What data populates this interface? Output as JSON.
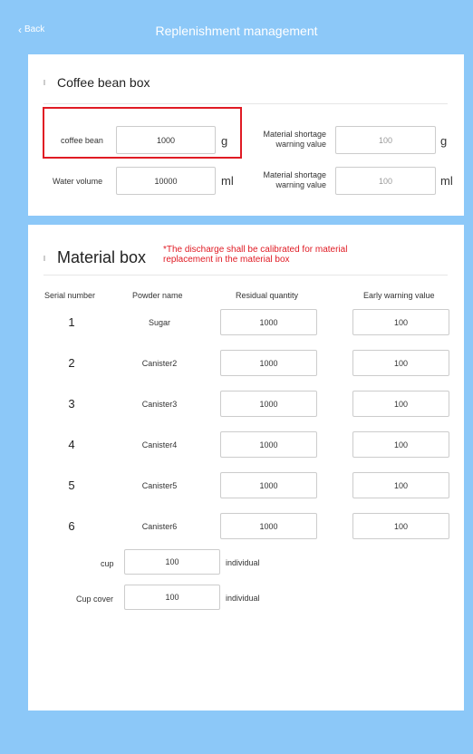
{
  "header": {
    "back_label": "Back",
    "title": "Replenishment management"
  },
  "coffee_section": {
    "title": "Coffee bean box",
    "coffee_bean_label": "coffee bean",
    "coffee_bean_value": "1000",
    "coffee_bean_unit": "g",
    "bean_warning_label_1": "Material shortage",
    "bean_warning_label_2": "warning value",
    "bean_warning_value": "100",
    "bean_warning_unit": "g",
    "water_label": "Water volume",
    "water_value": "10000",
    "water_unit": "ml",
    "water_warning_label_1": "Material shortage",
    "water_warning_label_2": "warning value",
    "water_warning_value": "100",
    "water_warning_unit": "ml"
  },
  "material_section": {
    "title": "Material box",
    "note_line1": "*The discharge shall be calibrated for material",
    "note_line2": "replacement in the material box",
    "columns": [
      "Serial number",
      "Powder name",
      "Residual quantity",
      "Early warning value"
    ],
    "rows": [
      {
        "serial": "1",
        "name": "Sugar",
        "residual": "1000",
        "warning": "100"
      },
      {
        "serial": "2",
        "name": "Canister2",
        "residual": "1000",
        "warning": "100"
      },
      {
        "serial": "3",
        "name": "Canister3",
        "residual": "1000",
        "warning": "100"
      },
      {
        "serial": "4",
        "name": "Canister4",
        "residual": "1000",
        "warning": "100"
      },
      {
        "serial": "5",
        "name": "Canister5",
        "residual": "1000",
        "warning": "100"
      },
      {
        "serial": "6",
        "name": "Canister6",
        "residual": "1000",
        "warning": "100"
      }
    ],
    "cup_label": "cup",
    "cup_value": "100",
    "cup_unit": "individual",
    "cover_label": "Cup cover",
    "cover_value": "100",
    "cover_unit": "individual"
  }
}
